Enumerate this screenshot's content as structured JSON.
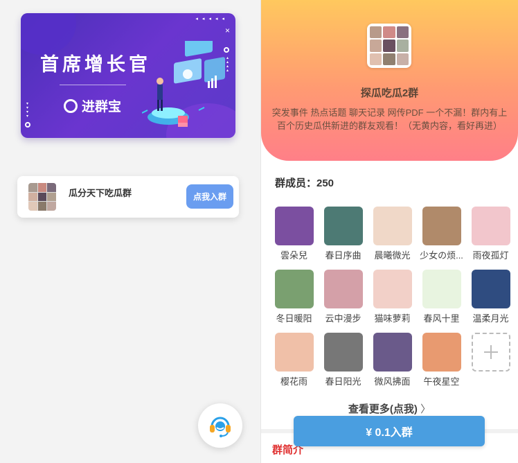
{
  "banner": {
    "title": "首席增长官",
    "brand": "进群宝",
    "close": "×"
  },
  "group_card": {
    "name": "瓜分天下吃瓜群",
    "join_label": "点我入群"
  },
  "group_detail": {
    "name": "探瓜吃瓜2群",
    "description": "突发事件 热点话题 聊天记录 网传PDF 一个不漏！群内有上百个历史瓜供新进的群友观看！（无黄内容，看好再进）",
    "members_count": "群成员：250",
    "more_label": "查看更多(点我)",
    "intro_label": "群简介",
    "pay_label": "¥ 0.1入群"
  },
  "members": [
    {
      "name": "雲朵兒",
      "color": "#7b4fa0"
    },
    {
      "name": "春日序曲",
      "color": "#4d7a74"
    },
    {
      "name": "晨曦微光",
      "color": "#f0d8c8"
    },
    {
      "name": "少女の烦...",
      "color": "#b08a6a"
    },
    {
      "name": "雨夜孤灯",
      "color": "#f2c6cc"
    },
    {
      "name": "冬日暖阳",
      "color": "#7aa070"
    },
    {
      "name": "云中漫步",
      "color": "#d4a0a8"
    },
    {
      "name": "猫味萝莉",
      "color": "#f2d0c8"
    },
    {
      "name": "春风十里",
      "color": "#e8f4e0"
    },
    {
      "name": "温柔月光",
      "color": "#2f4c80"
    },
    {
      "name": "樱花雨",
      "color": "#f0c0a8"
    },
    {
      "name": "春日阳光",
      "color": "#777777"
    },
    {
      "name": "微风拂面",
      "color": "#6a5a8a"
    },
    {
      "name": "午夜星空",
      "color": "#e89a70"
    }
  ],
  "colors": {
    "accent_blue": "#4a9ee0",
    "join_button": "#6a9df0",
    "banner_purple": "#5b3ac9",
    "intro_red": "#e03030"
  }
}
